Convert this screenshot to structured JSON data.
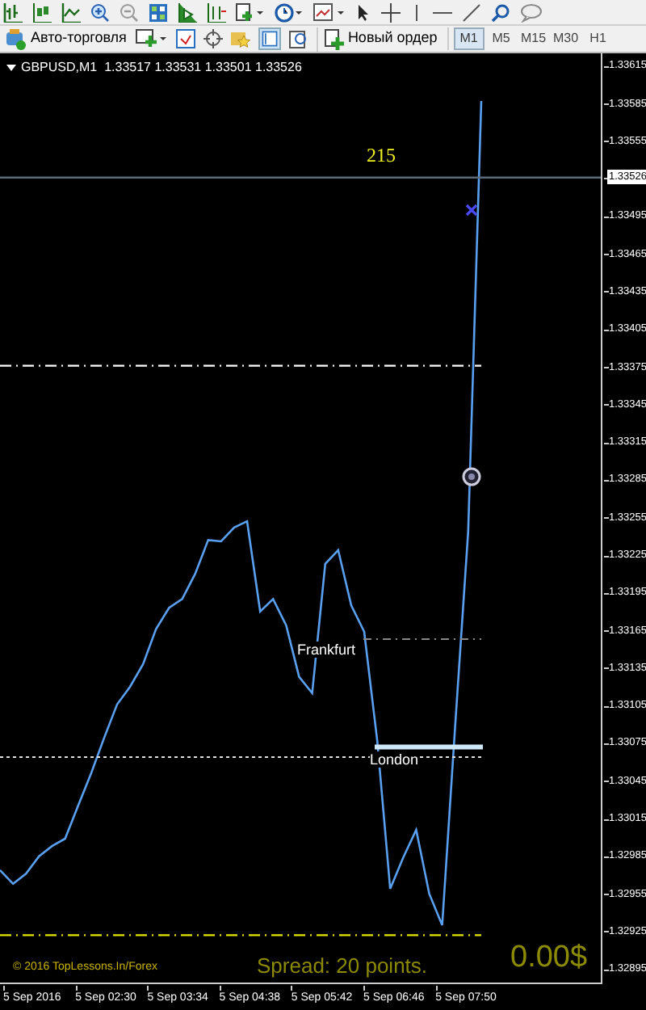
{
  "toolbar": {
    "autotrading_label": "Авто-торговля",
    "new_order_label": "Новый ордер"
  },
  "timeframes": [
    {
      "label": "M1",
      "selected": true
    },
    {
      "label": "M5",
      "selected": false
    },
    {
      "label": "M15",
      "selected": false
    },
    {
      "label": "M30",
      "selected": false
    },
    {
      "label": "H1",
      "selected": false
    }
  ],
  "chart": {
    "header": "GBPUSD,M1  1.33517 1.33531 1.33501 1.33526",
    "counter": "215",
    "session_labels": [
      "Frankfurt",
      "London"
    ],
    "copyright": "© 2016 TopLessons.In/Forex",
    "spread": "Spread: 20 points.",
    "profit": "0.00$",
    "current_price": "1.33526",
    "time_axis": [
      "5 Sep 2016",
      "5 Sep 02:30",
      "5 Sep 03:34",
      "5 Sep 04:38",
      "5 Sep 05:42",
      "5 Sep 06:46",
      "5 Sep 07:50"
    ],
    "chart_data": {
      "type": "line",
      "ylim": [
        1.32883,
        1.33625
      ],
      "ref_lines": [
        {
          "axis": "y",
          "value": 1.33526,
          "color": "#5a6a78"
        },
        {
          "axis": "y",
          "value": 1.33376,
          "color": "#ffffff"
        },
        {
          "axis": "y",
          "value": 1.33158,
          "color": "#888888"
        },
        {
          "axis": "y",
          "value": 1.33072,
          "color": "#cde8f8"
        },
        {
          "axis": "y",
          "value": 1.33064,
          "color": "#e0e0e0"
        },
        {
          "axis": "y",
          "value": 1.32922,
          "color": "#e6e600"
        }
      ],
      "yticks": [
        {
          "value": 1.33615,
          "label": "1.33615"
        },
        {
          "value": 1.33585,
          "label": "1.33585"
        },
        {
          "value": 1.33555,
          "label": "1.33555"
        },
        {
          "value": 1.33495,
          "label": "1.33495"
        },
        {
          "value": 1.33465,
          "label": "1.33465"
        },
        {
          "value": 1.33435,
          "label": "1.33435"
        },
        {
          "value": 1.33405,
          "label": "1.33405"
        },
        {
          "value": 1.33375,
          "label": "1.33375"
        },
        {
          "value": 1.33345,
          "label": "1.33345"
        },
        {
          "value": 1.33315,
          "label": "1.33315"
        },
        {
          "value": 1.33285,
          "label": "1.33285"
        },
        {
          "value": 1.33255,
          "label": "1.33255"
        },
        {
          "value": 1.33225,
          "label": "1.33225"
        },
        {
          "value": 1.33195,
          "label": "1.33195"
        },
        {
          "value": 1.33165,
          "label": "1.33165"
        },
        {
          "value": 1.33135,
          "label": "1.33135"
        },
        {
          "value": 1.33105,
          "label": "1.33105"
        },
        {
          "value": 1.33075,
          "label": "1.33075"
        },
        {
          "value": 1.33045,
          "label": "1.33045"
        },
        {
          "value": 1.33015,
          "label": "1.33015"
        },
        {
          "value": 1.32985,
          "label": "1.32985"
        },
        {
          "value": 1.32955,
          "label": "1.32955"
        },
        {
          "value": 1.32925,
          "label": "1.32925"
        },
        {
          "value": 1.32895,
          "label": "1.32895"
        }
      ],
      "series": [
        {
          "color": "#5aa0f0",
          "values": [
            1.32974,
            1.32963,
            1.32971,
            1.32985,
            1.32993,
            1.32999,
            1.33025,
            1.33051,
            1.33079,
            1.33106,
            1.3312,
            1.33138,
            1.33166,
            1.33183,
            1.3319,
            1.3321,
            1.33237,
            1.33236,
            1.33247,
            1.33252,
            1.3318,
            1.3319,
            1.33169,
            1.33128,
            1.33115,
            1.33218,
            1.33229,
            1.33185,
            1.33164,
            1.33077,
            1.32959,
            1.32984,
            1.33006,
            1.32955,
            1.3293,
            1.3309,
            1.33244,
            1.33587
          ]
        }
      ]
    }
  }
}
